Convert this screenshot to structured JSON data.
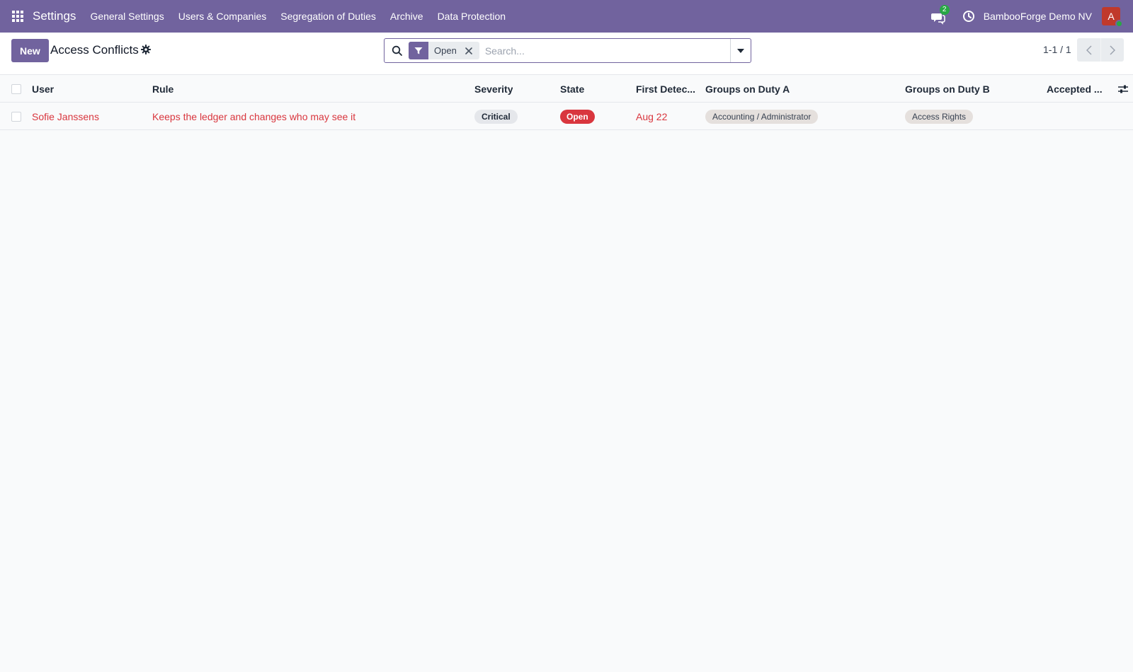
{
  "navbar": {
    "app_name": "Settings",
    "menu": [
      "General Settings",
      "Users & Companies",
      "Segregation of Duties",
      "Archive",
      "Data Protection"
    ],
    "chat_count": "2",
    "company": "BambooForge Demo NV",
    "avatar_letter": "A",
    "color": "#71639e"
  },
  "control_panel": {
    "new_label": "New",
    "title": "Access Conflicts",
    "search": {
      "facet": "Open",
      "placeholder": "Search..."
    },
    "pager": "1-1 / 1"
  },
  "table": {
    "headers": {
      "user": "User",
      "rule": "Rule",
      "severity": "Severity",
      "state": "State",
      "first_detected": "First Detec...",
      "groups_a": "Groups on Duty A",
      "groups_b": "Groups on Duty B",
      "accepted": "Accepted ..."
    },
    "rows": [
      {
        "user": "Sofie Janssens",
        "rule": "Keeps the ledger and changes who may see it",
        "severity": "Critical",
        "state": "Open",
        "first_detected": "Aug 22",
        "groups_a": "Accounting / Administrator",
        "groups_b": "Access Rights",
        "accepted": ""
      }
    ]
  }
}
